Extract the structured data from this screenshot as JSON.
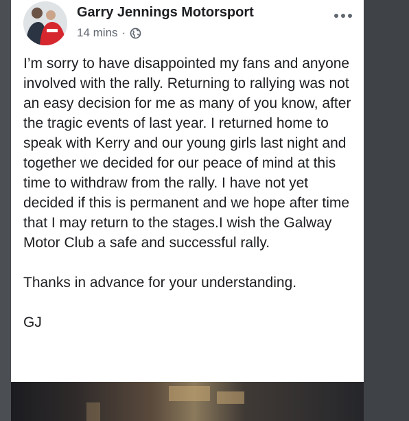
{
  "post": {
    "author": "Garry Jennings Motorsport",
    "time": "14 mins",
    "separator": "·",
    "paragraphs": [
      "I’m sorry to have disappointed my fans and anyone involved with the rally. Returning to rallying was not an easy decision for me as many of you know, after the tragic events of last year. I returned home to speak with Kerry and our young girls last night and together we decided for our peace of mind at this time to withdraw from the rally. I have not yet decided if this is permanent and we hope after time that I may return to the stages.I wish the Galway Motor Club a safe and successful rally.",
      "Thanks in advance for your understanding.",
      "GJ"
    ]
  },
  "icons": {
    "privacy": "globe-icon",
    "menu": "more-options-icon"
  },
  "colors": {
    "text": "#1c1e21",
    "meta": "#606770",
    "card": "#ffffff",
    "overlay": "#3a3d40"
  }
}
